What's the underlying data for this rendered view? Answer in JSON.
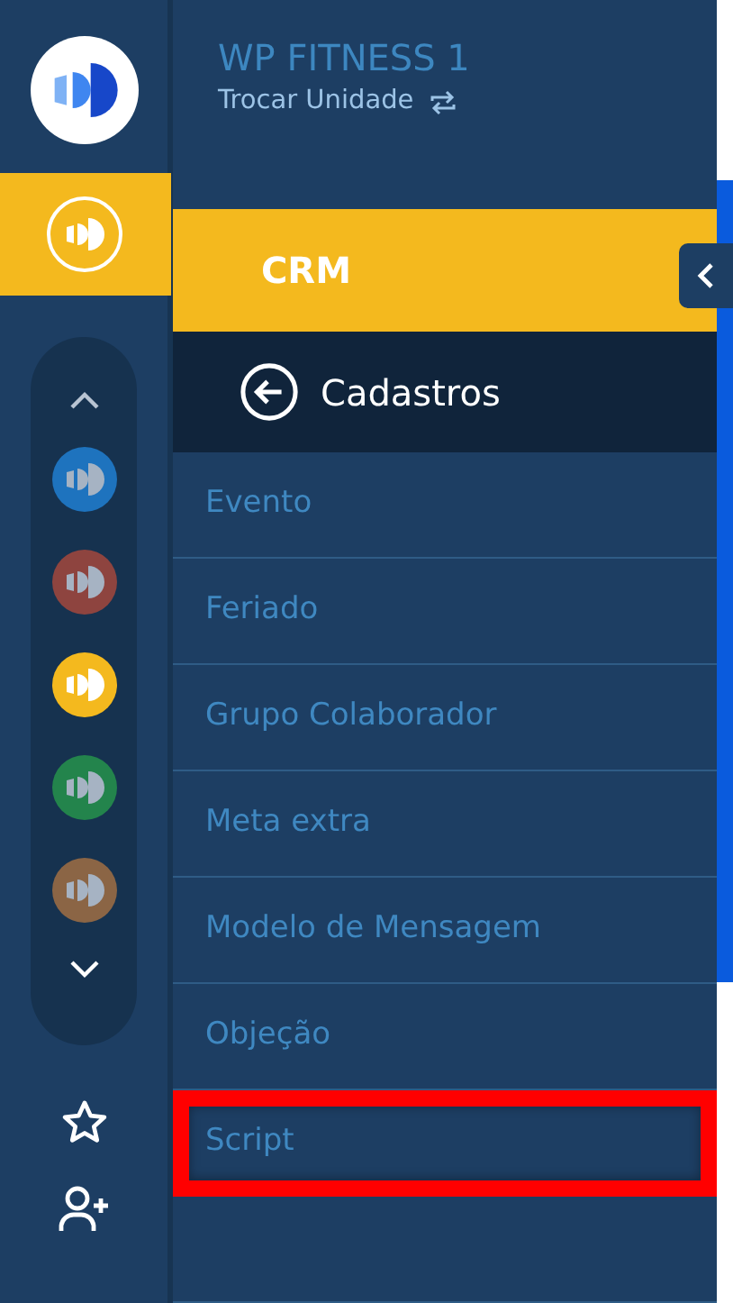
{
  "header": {
    "title": "WP FITNESS 1",
    "switch_label": "Trocar Unidade"
  },
  "module": {
    "label": "CRM",
    "selected": true
  },
  "section": {
    "title": "Cadastros"
  },
  "units": [
    {
      "color": "#1e73be",
      "selected": false
    },
    {
      "color": "#8e443f",
      "selected": false
    },
    {
      "color": "#f4b91e",
      "selected": true
    },
    {
      "color": "#23844c",
      "selected": false
    },
    {
      "color": "#8b6545",
      "selected": false
    }
  ],
  "menu_items": [
    {
      "label": "Evento",
      "highlighted": false
    },
    {
      "label": "Feriado",
      "highlighted": false
    },
    {
      "label": "Grupo Colaborador",
      "highlighted": false
    },
    {
      "label": "Meta extra",
      "highlighted": false
    },
    {
      "label": "Modelo de Mensagem",
      "highlighted": false
    },
    {
      "label": "Objeção",
      "highlighted": false
    },
    {
      "label": "Script",
      "highlighted": true
    }
  ]
}
